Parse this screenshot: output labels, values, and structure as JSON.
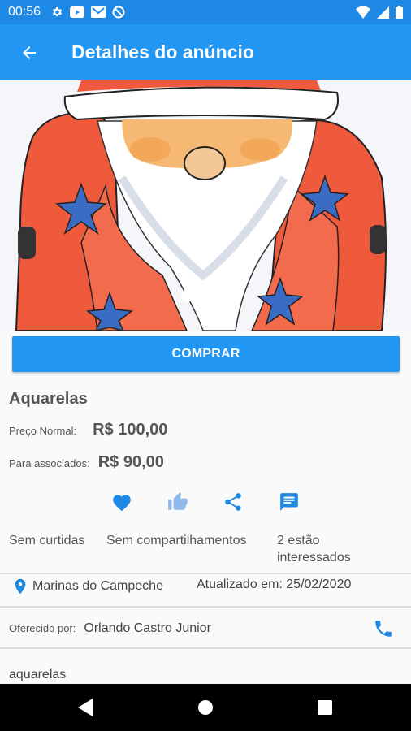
{
  "status_bar": {
    "time": "00:56",
    "icons": [
      "settings-icon",
      "youtube-icon",
      "gmail-icon",
      "sync-off-icon"
    ],
    "right_icons": [
      "wifi-icon",
      "signal-icon",
      "battery-icon"
    ]
  },
  "appbar": {
    "title": "Detalhes do anúncio",
    "back_icon": "arrow-back-icon"
  },
  "carousel": {
    "image_alt": "Aquarela Papai Noel",
    "pages": 3,
    "active_page": 1
  },
  "buy_button": "COMPRAR",
  "product": {
    "title": "Aquarelas",
    "normal_price_label": "Preço Normal:",
    "normal_price": "R$ 100,00",
    "member_price_label": "Para associados:",
    "member_price": "R$ 90,00"
  },
  "actions": {
    "likes_text": "Sem curtidas",
    "shares_text": "Sem compartilhamentos",
    "interested_line1": "2 estão",
    "interested_line2": "interessados"
  },
  "location": {
    "place": "Marinas do Campeche",
    "updated": "Atualizado em: 25/02/2020"
  },
  "offer": {
    "label": "Oferecido por:",
    "name": "Orlando Castro Junior"
  },
  "description": "aquarelas",
  "colors": {
    "primary": "#2196f3",
    "status_bar": "#1e88e5",
    "icon_blue": "#1e88e5",
    "icon_light": "#90b8e8"
  }
}
